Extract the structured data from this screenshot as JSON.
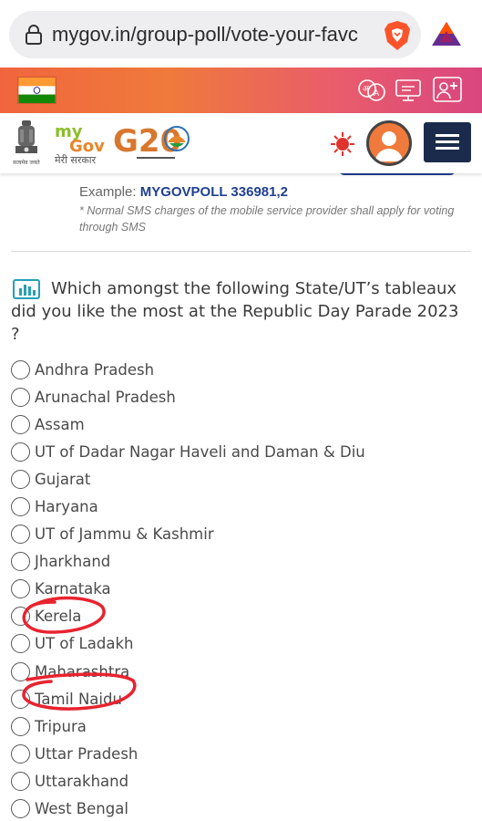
{
  "browser": {
    "url": "mygov.in/group-poll/vote-your-favc"
  },
  "header": {
    "logo_mygov_top": "my",
    "logo_mygov_bottom": "Gov",
    "logo_mygov_hindi": "मेरी सरकार",
    "logo_g20": "G20",
    "emblem_caption": "सत्यमेव जयते"
  },
  "sms": {
    "example_prefix": "Example:",
    "example_code": "MYGOVPOLL 336981,2",
    "note": "* Normal SMS charges of the mobile service provider shall apply for voting through SMS"
  },
  "poll": {
    "question": "Which amongst the following State/UT’s tableaux did you like the most at the Republic Day Parade 2023 ?",
    "options": [
      "Andhra Pradesh",
      "Arunachal Pradesh",
      "Assam",
      "UT of Dadar Nagar Haveli and Daman & Diu",
      "Gujarat",
      "Haryana",
      "UT of Jammu & Kashmir",
      "Jharkhand",
      "Karnataka",
      "Kerela",
      "UT of Ladakh",
      "Maharashtra",
      "Tamil Naidu",
      "Tripura",
      "Uttar Pradesh",
      "Uttarakhand",
      "West Bengal"
    ]
  },
  "colors": {
    "accent_orange": "#ef7a3b",
    "accent_pink": "#d9467f",
    "nav_blue": "#1b2b4b",
    "highlight_red": "#e8232f"
  }
}
